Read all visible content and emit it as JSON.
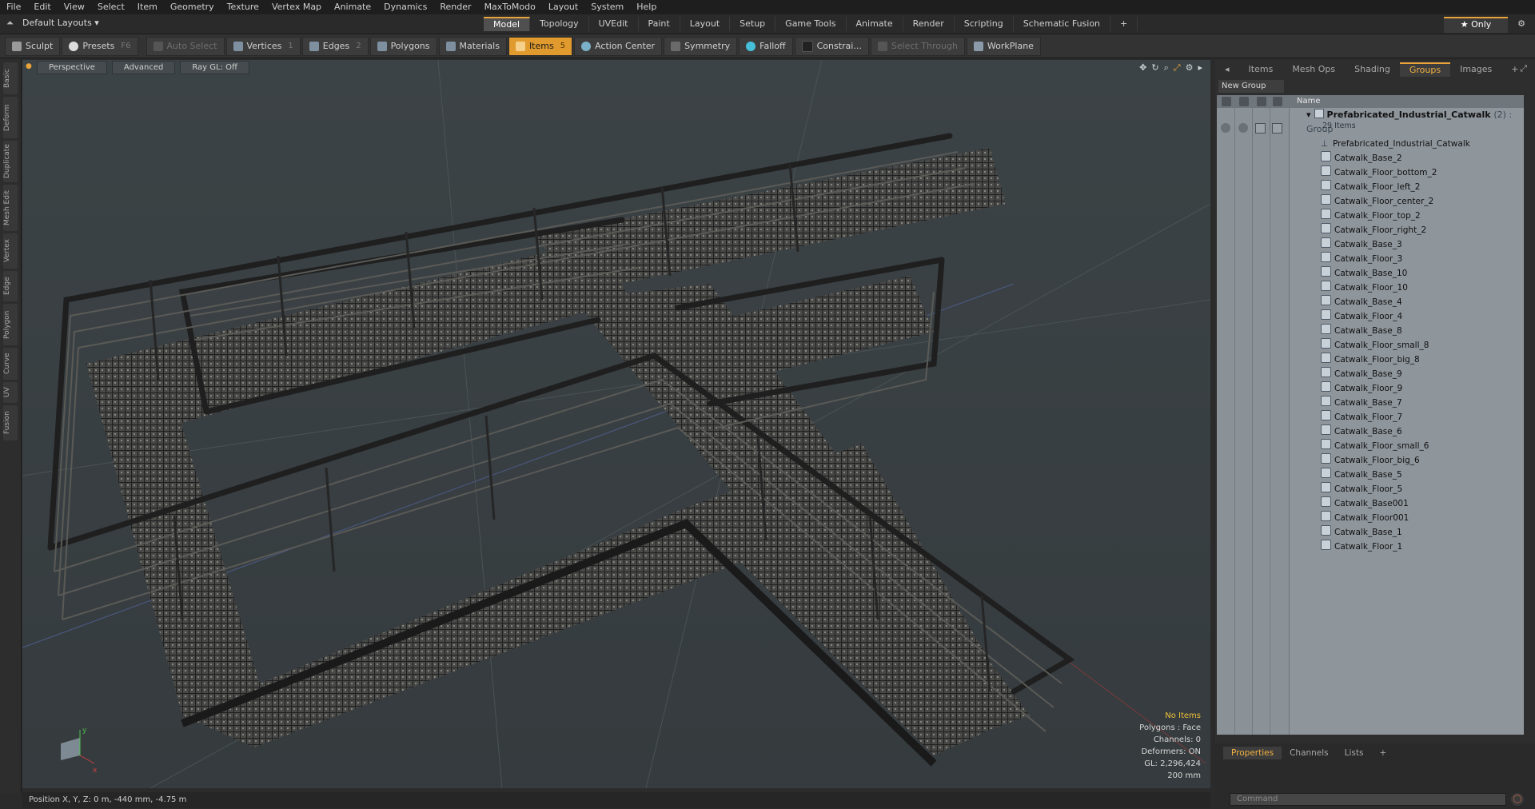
{
  "menu": [
    "File",
    "Edit",
    "View",
    "Select",
    "Item",
    "Geometry",
    "Texture",
    "Vertex Map",
    "Animate",
    "Dynamics",
    "Render",
    "MaxToModo",
    "Layout",
    "System",
    "Help"
  ],
  "layout_menu": "Default Layouts ▾",
  "layout_tabs": [
    "Model",
    "Topology",
    "UVEdit",
    "Paint",
    "Layout",
    "Setup",
    "Game Tools",
    "Animate",
    "Render",
    "Scripting",
    "Schematic Fusion"
  ],
  "layout_tab_active": "Model",
  "layout_add": "+",
  "only_label": "★ Only",
  "toolbar": {
    "sculpt": "Sculpt",
    "presets": "Presets",
    "presets_key": "F6",
    "auto_select": "Auto Select",
    "vertices": "Vertices",
    "vertices_key": "1",
    "edges": "Edges",
    "edges_key": "2",
    "polygons": "Polygons",
    "materials": "Materials",
    "items": "Items",
    "items_key": "5",
    "action_center": "Action Center",
    "symmetry": "Symmetry",
    "falloff": "Falloff",
    "constrain": "Constrai...",
    "select_through": "Select Through",
    "workplane": "WorkPlane"
  },
  "left_tabs": [
    "Basic",
    "Deform",
    "Duplicate",
    "Mesh Edit",
    "Vertex",
    "Edge",
    "Polygon",
    "Curve",
    "UV",
    "Fusion"
  ],
  "viewport": {
    "view": "Perspective",
    "advanced": "Advanced",
    "raygl": "Ray GL: Off",
    "info": {
      "items": "No Items",
      "polygons": "Polygons : Face",
      "channels": "Channels: 0",
      "deformers": "Deformers: ON",
      "gl": "GL: 2,296,424",
      "size": "200 mm"
    }
  },
  "status": "Position X, Y, Z:   0 m, -440 mm, -4.75 m",
  "right_panel": {
    "tabs": [
      "Items",
      "Mesh Ops",
      "Shading",
      "Groups",
      "Images"
    ],
    "tab_active": "Groups",
    "tab_add": "+",
    "new_group": "New Group",
    "col_name": "Name",
    "root_name": "Prefabricated_Industrial_Catwalk",
    "root_tag": "(2) : Group",
    "root_count": "29 Items",
    "items": [
      {
        "name": "Prefabricated_Industrial_Catwalk",
        "icon": "locator-icon"
      },
      {
        "name": "Catwalk_Base_2",
        "icon": "mesh-icon"
      },
      {
        "name": "Catwalk_Floor_bottom_2",
        "icon": "mesh-icon"
      },
      {
        "name": "Catwalk_Floor_left_2",
        "icon": "mesh-icon"
      },
      {
        "name": "Catwalk_Floor_center_2",
        "icon": "mesh-icon"
      },
      {
        "name": "Catwalk_Floor_top_2",
        "icon": "mesh-icon"
      },
      {
        "name": "Catwalk_Floor_right_2",
        "icon": "mesh-icon"
      },
      {
        "name": "Catwalk_Base_3",
        "icon": "mesh-icon"
      },
      {
        "name": "Catwalk_Floor_3",
        "icon": "mesh-icon"
      },
      {
        "name": "Catwalk_Base_10",
        "icon": "mesh-icon"
      },
      {
        "name": "Catwalk_Floor_10",
        "icon": "mesh-icon"
      },
      {
        "name": "Catwalk_Base_4",
        "icon": "mesh-icon"
      },
      {
        "name": "Catwalk_Floor_4",
        "icon": "mesh-icon"
      },
      {
        "name": "Catwalk_Base_8",
        "icon": "mesh-icon"
      },
      {
        "name": "Catwalk_Floor_small_8",
        "icon": "mesh-icon"
      },
      {
        "name": "Catwalk_Floor_big_8",
        "icon": "mesh-icon"
      },
      {
        "name": "Catwalk_Base_9",
        "icon": "mesh-icon"
      },
      {
        "name": "Catwalk_Floor_9",
        "icon": "mesh-icon"
      },
      {
        "name": "Catwalk_Base_7",
        "icon": "mesh-icon"
      },
      {
        "name": "Catwalk_Floor_7",
        "icon": "mesh-icon"
      },
      {
        "name": "Catwalk_Base_6",
        "icon": "mesh-icon"
      },
      {
        "name": "Catwalk_Floor_small_6",
        "icon": "mesh-icon"
      },
      {
        "name": "Catwalk_Floor_big_6",
        "icon": "mesh-icon"
      },
      {
        "name": "Catwalk_Base_5",
        "icon": "mesh-icon"
      },
      {
        "name": "Catwalk_Floor_5",
        "icon": "mesh-icon"
      },
      {
        "name": "Catwalk_Base001",
        "icon": "mesh-icon"
      },
      {
        "name": "Catwalk_Floor001",
        "icon": "mesh-icon"
      },
      {
        "name": "Catwalk_Base_1",
        "icon": "mesh-icon"
      },
      {
        "name": "Catwalk_Floor_1",
        "icon": "mesh-icon"
      }
    ],
    "bottom_tabs": [
      "Properties",
      "Channels",
      "Lists"
    ],
    "bottom_tab_active": "Properties",
    "bottom_add": "+",
    "command_placeholder": "Command"
  },
  "colors": {
    "accent": "#e8a33a",
    "viewport_bg": "#3a4144",
    "tree_bg": "#8e959b"
  }
}
